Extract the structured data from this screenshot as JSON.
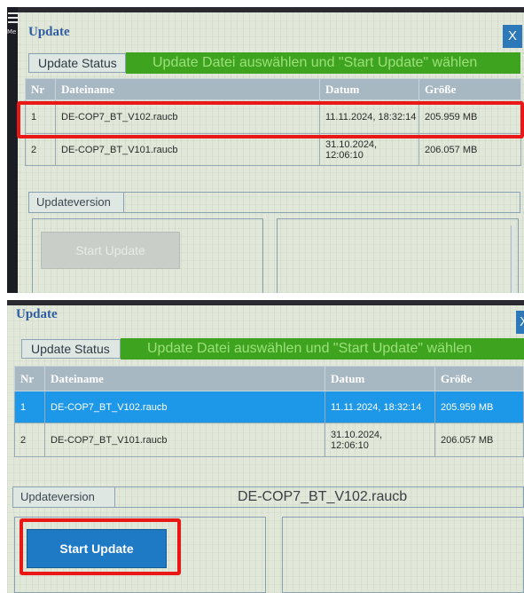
{
  "screens": [
    {
      "menu_label": "Me",
      "dialog_title": "Update",
      "close_label": "X",
      "status_label": "Update Status",
      "status_message": "Update Datei auswählen und \"Start Update\" wählen",
      "columns": [
        "Nr",
        "Dateiname",
        "Datum",
        "Größe"
      ],
      "rows": [
        {
          "nr": "1",
          "name": "DE-COP7_BT_V102.raucb",
          "date": "11.11.2024, 18:32:14",
          "size": "205.959 MB",
          "selected": false
        },
        {
          "nr": "2",
          "name": "DE-COP7_BT_V101.raucb",
          "date": "31.10.2024,\n12:06:10",
          "size": "206.057 MB",
          "selected": false
        }
      ],
      "updateversion_label": "Updateversion",
      "updateversion_value": "",
      "start_button": "Start Update",
      "start_enabled": false
    },
    {
      "dialog_title": "Update",
      "close_label": "X",
      "status_label": "Update Status",
      "status_message": "Update Datei auswählen und \"Start Update\" wählen",
      "columns": [
        "Nr",
        "Dateiname",
        "Datum",
        "Größe"
      ],
      "rows": [
        {
          "nr": "1",
          "name": "DE-COP7_BT_V102.raucb",
          "date": "11.11.2024, 18:32:14",
          "size": "205.959 MB",
          "selected": true
        },
        {
          "nr": "2",
          "name": "DE-COP7_BT_V101.raucb",
          "date": "31.10.2024,\n12:06:10",
          "size": "206.057 MB",
          "selected": false
        }
      ],
      "updateversion_label": "Updateversion",
      "updateversion_value": "DE-COP7_BT_V102.raucb",
      "start_button": "Start Update",
      "start_enabled": true
    }
  ],
  "colors": {
    "status_bar": "#3ea41f",
    "selected_row": "#1d97e8",
    "highlight": "#ea1717",
    "button_enabled": "#1e7ac4",
    "title": "#2f5ca0"
  }
}
